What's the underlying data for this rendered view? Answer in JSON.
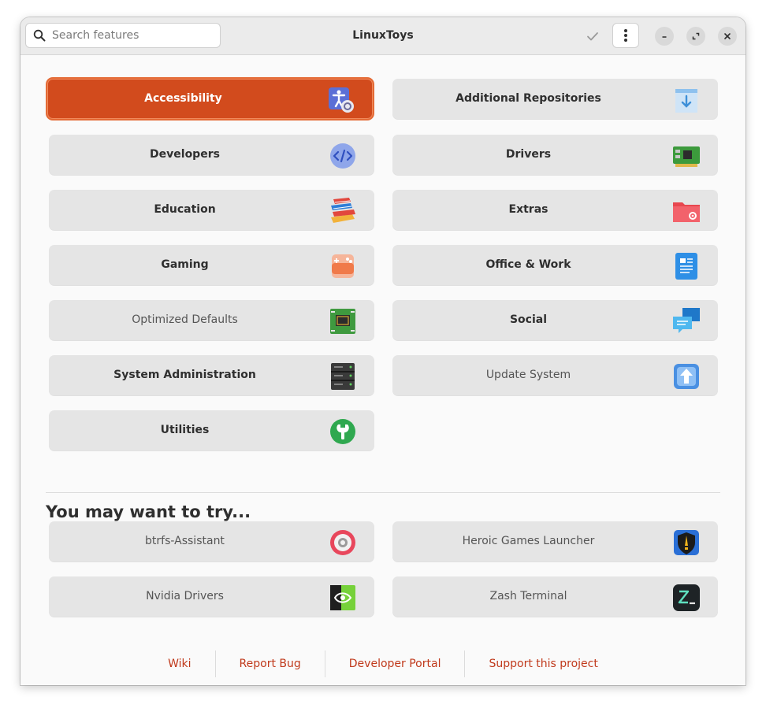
{
  "window": {
    "title": "LinuxToys"
  },
  "search": {
    "placeholder": "Search features",
    "value": ""
  },
  "header_icons": {
    "check": "check-icon",
    "menu": "kebab-menu-icon",
    "minimize": "minimize-icon",
    "maximize": "maximize-icon",
    "close": "close-icon"
  },
  "categories": [
    {
      "label": "Accessibility",
      "icon": "accessibility-icon",
      "active": true
    },
    {
      "label": "Additional Repositories",
      "icon": "repository-icon"
    },
    {
      "label": "Developers",
      "icon": "code-icon"
    },
    {
      "label": "Drivers",
      "icon": "circuit-board-icon"
    },
    {
      "label": "Education",
      "icon": "books-icon"
    },
    {
      "label": "Extras",
      "icon": "folder-settings-icon"
    },
    {
      "label": "Gaming",
      "icon": "gamepad-icon"
    },
    {
      "label": "Office & Work",
      "icon": "document-icon"
    },
    {
      "label": "Optimized Defaults",
      "icon": "cpu-chip-icon"
    },
    {
      "label": "Social",
      "icon": "chat-bubbles-icon"
    },
    {
      "label": "System Administration",
      "icon": "server-rack-icon"
    },
    {
      "label": "Update System",
      "icon": "update-arrow-icon"
    },
    {
      "label": "Utilities",
      "icon": "wrench-icon"
    }
  ],
  "suggestions": {
    "title": "You may want to try...",
    "items": [
      {
        "label": "btrfs-Assistant",
        "icon": "disk-icon"
      },
      {
        "label": "Heroic Games Launcher",
        "icon": "heroic-shield-icon"
      },
      {
        "label": "Nvidia Drivers",
        "icon": "nvidia-icon"
      },
      {
        "label": "Zash Terminal",
        "icon": "terminal-z-icon"
      }
    ]
  },
  "footer": {
    "links": [
      "Wiki",
      "Report Bug",
      "Developer Portal",
      "Support this project"
    ]
  },
  "colors": {
    "accent": "#d24b1d",
    "link": "#c0391b",
    "card": "#e5e5e5"
  }
}
